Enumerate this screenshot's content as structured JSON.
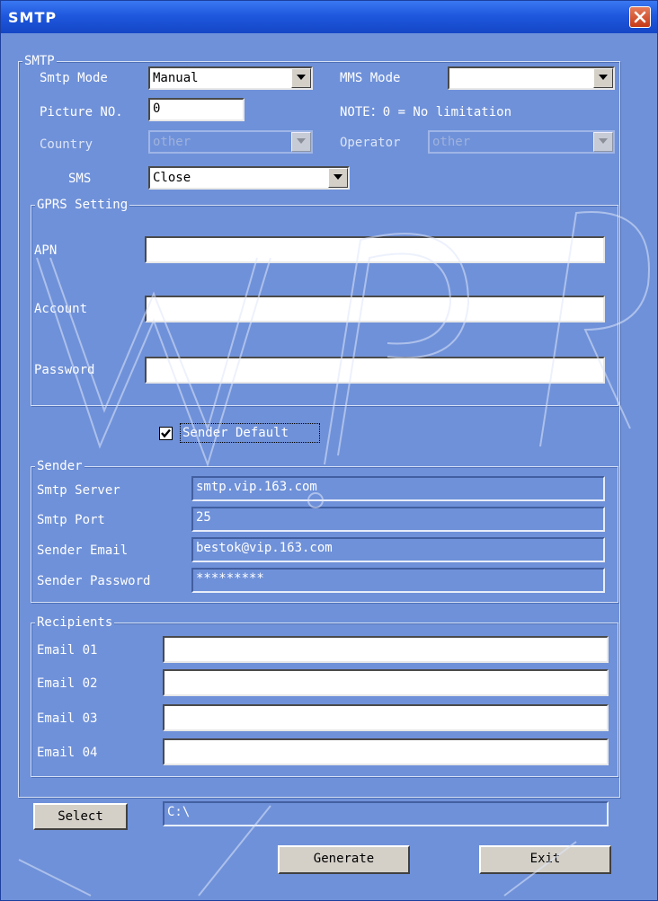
{
  "window": {
    "title": "SMTP"
  },
  "smtp_group": {
    "legend": "SMTP",
    "smtp_mode_label": "Smtp Mode",
    "smtp_mode_value": "Manual",
    "mms_mode_label": "MMS Mode",
    "mms_mode_value": "",
    "picture_no_label": "Picture NO.",
    "picture_no_value": "0",
    "note": "NOTE：0 = No limitation",
    "country_label": "Country",
    "country_value": "other",
    "operator_label": "Operator",
    "operator_value": "other",
    "sms_label": "SMS",
    "sms_value": "Close"
  },
  "gprs_group": {
    "legend": "GPRS Setting",
    "apn_label": "APN",
    "apn_value": "",
    "account_label": "Account",
    "account_value": "",
    "password_label": "Password",
    "password_value": ""
  },
  "sender_default": {
    "label": "Sender Default",
    "checked": true
  },
  "sender_group": {
    "legend": "Sender",
    "server_label": "Smtp Server",
    "server_value": "smtp.vip.163.com",
    "port_label": "Smtp Port",
    "port_value": "25",
    "email_label": "Sender Email",
    "email_value": "bestok@vip.163.com",
    "password_label": "Sender Password",
    "password_value": "*********"
  },
  "recipients_group": {
    "legend": "Recipients",
    "email1_label": "Email 01",
    "email2_label": "Email 02",
    "email3_label": "Email 03",
    "email4_label": "Email 04",
    "email1_value": "",
    "email2_value": "",
    "email3_value": "",
    "email4_value": ""
  },
  "footer": {
    "select_label": "Select",
    "path_value": "C:\\",
    "generate_label": "Generate",
    "exit_label": "Exit"
  },
  "colors": {
    "dialog_bg": "#6f91d9",
    "titlebar": "#1f58de",
    "close_button": "#c63a16"
  },
  "watermark": "WWW.P...R"
}
